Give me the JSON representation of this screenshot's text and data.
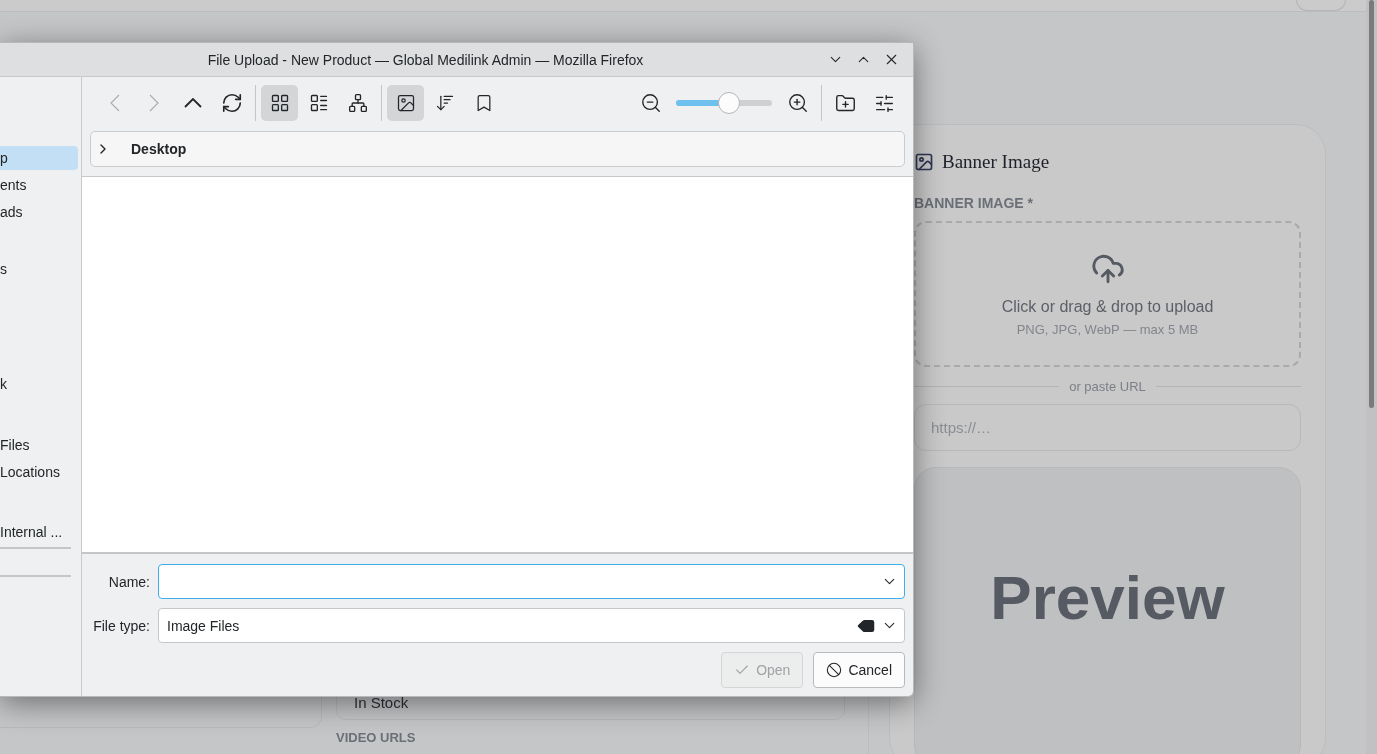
{
  "page": {
    "left_card": {
      "stock_select": {
        "value": "In Stock"
      },
      "video_urls_label": "VIDEO URLS"
    },
    "banner_card": {
      "title": "Banner Image",
      "field_label": "BANNER IMAGE *",
      "dropzone_text": "Click or drag & drop to upload",
      "dropzone_hint": "PNG, JPG, WebP — max 5 MB",
      "divider_text": "or paste URL",
      "url_placeholder": "https://…",
      "preview_text": "Preview"
    }
  },
  "dialog": {
    "title": "File Upload - New Product — Global Medilink Admin — Mozilla Firefox",
    "window_controls": [
      {
        "kind": "minimize"
      },
      {
        "kind": "maximize"
      },
      {
        "kind": "close"
      }
    ],
    "nav_buttons": [
      {
        "kind": "back",
        "disabled": true
      },
      {
        "kind": "forward",
        "disabled": true
      },
      {
        "kind": "up",
        "disabled": false
      },
      {
        "kind": "reload",
        "disabled": false
      }
    ],
    "view_modes": [
      {
        "kind": "icons",
        "selected": true
      },
      {
        "kind": "compact",
        "selected": false
      },
      {
        "kind": "tree",
        "selected": false
      }
    ],
    "view_toggles": [
      {
        "kind": "preview",
        "selected": true
      },
      {
        "kind": "sort",
        "selected": false
      },
      {
        "kind": "bookmark",
        "selected": false
      }
    ],
    "zoom": {
      "level": 0.55
    },
    "breadcrumb": "Desktop",
    "sidebar": [
      {
        "label": "p",
        "selected": true
      },
      {
        "label": "ents",
        "selected": false
      },
      {
        "label": "ads",
        "selected": false
      },
      {
        "label": "s",
        "selected": false
      },
      {
        "label": "k",
        "selected": false
      },
      {
        "label": "Files",
        "selected": false
      },
      {
        "label": "Locations",
        "selected": false
      },
      {
        "label": "Internal ...",
        "selected": false
      }
    ],
    "name_label": "Name:",
    "name_field": {
      "focused": true
    },
    "file_type_label": "File type:",
    "file_type_value": "Image Files",
    "buttons": [
      {
        "kind": "open",
        "label": "Open",
        "disabled": true
      },
      {
        "kind": "cancel",
        "label": "Cancel",
        "disabled": false
      }
    ]
  }
}
